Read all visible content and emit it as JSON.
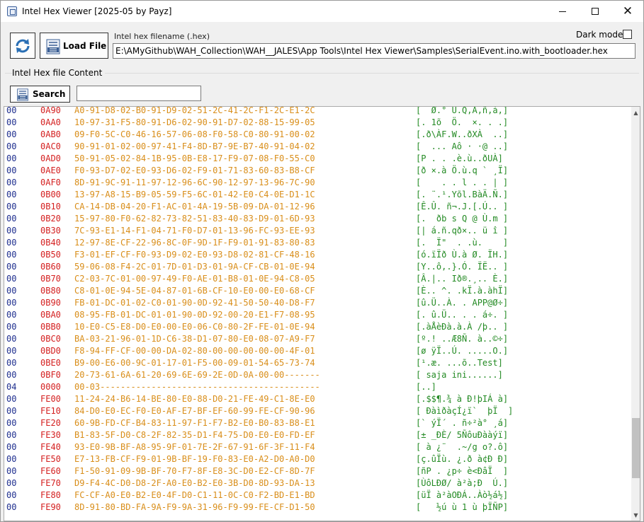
{
  "window": {
    "title": "Intel Hex Viewer [2025-05 by Payz]"
  },
  "toolbar": {
    "load_label": "Load File",
    "filename_label": "Intel hex filename (.hex)",
    "filename_value": "E:\\AMyGithub\\WAH_Collection\\WAH__JALES\\App Tools\\Intel Hex Viewer\\Samples\\SerialEvent.ino.with_bootloader.hex",
    "dark_mode_label": "Dark mode",
    "dark_mode_checked": false
  },
  "content": {
    "group_label": "Intel Hex file Content",
    "search_label": "Search",
    "search_value": ""
  },
  "colors": {
    "record_type": "#1f2f8f",
    "address": "#d42020",
    "hex_data": "#d98e1a",
    "ascii": "#238a23"
  },
  "rows": [
    {
      "type": "00",
      "addr": "0A90",
      "hex": "A0-91-D8-02-B0-91-D9-02-51-2C-41-2C-F1-2C-E1-2C",
      "ascii": "[  Ø.° Ù.Q,A,ñ,á,]"
    },
    {
      "type": "00",
      "addr": "0AA0",
      "hex": "10-97-31-F5-80-91-D6-02-90-91-D7-02-88-15-99-05",
      "ascii": "[. 1õ  Ö.  ×. . .]"
    },
    {
      "type": "00",
      "addr": "0AB0",
      "hex": "09-F0-5C-C0-46-16-57-06-08-F0-58-C0-80-91-00-02",
      "ascii": "[.ð\\ÀF.W..ðXÀ  ..]"
    },
    {
      "type": "00",
      "addr": "0AC0",
      "hex": "90-91-01-02-00-97-41-F4-8D-B7-9E-B7-40-91-04-02",
      "ascii": "[  ... Aô · ·@ ..]"
    },
    {
      "type": "00",
      "addr": "0AD0",
      "hex": "50-91-05-02-84-1B-95-0B-E8-17-F9-07-08-F0-55-C0",
      "ascii": "[P . . .è.ù..ðUÀ]"
    },
    {
      "type": "00",
      "addr": "0AE0",
      "hex": "F0-93-D7-02-E0-93-D6-02-F9-01-71-83-60-83-B8-CF",
      "ascii": "[ð ×.à Ö.ù.q ` ¸Ï]"
    },
    {
      "type": "00",
      "addr": "0AF0",
      "hex": "8D-91-9C-91-11-97-12-96-6C-90-12-97-13-96-7C-90",
      "ascii": "[    . . l . . | ]"
    },
    {
      "type": "00",
      "addr": "0B00",
      "hex": "13-97-A8-15-B9-05-59-F5-6C-01-42-E0-C4-0E-D1-1C",
      "ascii": "[. ¨.¹.Yõl.BàÄ.Ñ.]"
    },
    {
      "type": "00",
      "addr": "0B10",
      "hex": "CA-14-DB-04-20-F1-AC-01-4A-19-5B-09-DA-01-12-96",
      "ascii": "[Ê.Û. ñ¬.J.[.Ú.. ]"
    },
    {
      "type": "00",
      "addr": "0B20",
      "hex": "15-97-80-F0-62-82-73-82-51-83-40-83-D9-01-6D-93",
      "ascii": "[.  ðb s Q @ Ù.m ]"
    },
    {
      "type": "00",
      "addr": "0B30",
      "hex": "7C-93-E1-14-F1-04-71-F0-D7-01-13-96-FC-93-EE-93",
      "ascii": "[| á.ñ.qð×.. ü î ]"
    },
    {
      "type": "00",
      "addr": "0B40",
      "hex": "12-97-8E-CF-22-96-8C-0F-9D-1F-F9-01-91-83-80-83",
      "ascii": "[.  Ï\"  . .ù.    ]"
    },
    {
      "type": "00",
      "addr": "0B50",
      "hex": "F3-01-EF-CF-F0-93-D9-02-E0-93-D8-02-81-CF-48-16",
      "ascii": "[ó.ïÏð Ù.à Ø. ÏH.]"
    },
    {
      "type": "00",
      "addr": "0B60",
      "hex": "59-06-08-F4-2C-01-7D-01-D3-01-9A-CF-CB-01-0E-94",
      "ascii": "[Y..ô,.}.Ó. ÏË.. ]"
    },
    {
      "type": "00",
      "addr": "0B70",
      "hex": "C2-03-7C-01-00-97-49-F0-AE-01-B8-01-0E-94-C8-05",
      "ascii": "[Â.|.. Ið®.¸.. È.]"
    },
    {
      "type": "00",
      "addr": "0B80",
      "hex": "C8-01-0E-94-5E-04-87-01-6B-CF-10-E0-00-E0-68-CF",
      "ascii": "[È.. ^. .kÏ.à.àhÏ]"
    },
    {
      "type": "00",
      "addr": "0B90",
      "hex": "FB-01-DC-01-02-C0-01-90-0D-92-41-50-50-40-D8-F7",
      "ascii": "[û.Ü..À. . APP@Ø÷]"
    },
    {
      "type": "00",
      "addr": "0BA0",
      "hex": "08-95-FB-01-DC-01-01-90-0D-92-00-20-E1-F7-08-95",
      "ascii": "[. û.Ü.. . . á÷. ]"
    },
    {
      "type": "00",
      "addr": "0BB0",
      "hex": "10-E0-C5-E8-D0-E0-00-E0-06-C0-80-2F-FE-01-0E-94",
      "ascii": "[.àÅèÐà.à.À /þ.. ]"
    },
    {
      "type": "00",
      "addr": "0BC0",
      "hex": "BA-03-21-96-01-1D-C6-38-D1-07-80-E0-08-07-A9-F7",
      "ascii": "[º.! ..Æ8Ñ. à..©÷]"
    },
    {
      "type": "00",
      "addr": "0BD0",
      "hex": "F8-94-FF-CF-00-00-DA-02-80-00-00-00-00-00-4F-01",
      "ascii": "[ø ÿÏ..Ú. .....O.]"
    },
    {
      "type": "00",
      "addr": "0BE0",
      "hex": "B9-00-E6-00-9C-01-17-01-F5-00-09-01-54-65-73-74",
      "ascii": "[¹.æ. ...õ..Test]"
    },
    {
      "type": "00",
      "addr": "0BF0",
      "hex": "20-73-61-6A-61-20-69-6E-69-2E-0D-0A-00-00-------",
      "ascii": "[ saja ini......]"
    },
    {
      "type": "04",
      "addr": "0000",
      "hex": "00-03-------------------------------------------",
      "ascii": "[..]"
    },
    {
      "type": "00",
      "addr": "FE00",
      "hex": "11-24-24-B6-14-BE-80-E0-88-D0-21-FE-49-C1-8E-E0",
      "ascii": "[.$$¶.¾ à Ð!þIÁ à]"
    },
    {
      "type": "00",
      "addr": "FE10",
      "hex": "84-D0-E0-EC-F0-E0-AF-E7-BF-EF-60-99-FE-CF-90-96",
      "ascii": "[ ÐàìðàçÍ¿ï`  þÏ  ]"
    },
    {
      "type": "00",
      "addr": "FE20",
      "hex": "60-9B-FD-CF-B4-83-11-97-F1-F7-B2-E0-B0-83-B8-E1",
      "ascii": "[` ýÏ´ . ñ÷²à° ¸á]"
    },
    {
      "type": "00",
      "addr": "FE30",
      "hex": "B1-83-5F-D0-C8-2F-82-35-D1-F4-75-D0-E0-E0-FD-EF",
      "ascii": "[± _ÐÈ/ 5ÑôuÐààýï]"
    },
    {
      "type": "00",
      "addr": "FE40",
      "hex": "93-E0-9B-BF-A8-95-9F-01-7E-2F-67-91-6F-3F-11-F4",
      "ascii": "[ à ¿¨  .~/g o?.ô]"
    },
    {
      "type": "00",
      "addr": "FE50",
      "hex": "E7-13-FB-CF-F9-01-9B-BF-19-F0-83-E0-A2-D0-A0-D0",
      "ascii": "[ç.ûÏù. ¿.ð à¢Ð Ð]"
    },
    {
      "type": "00",
      "addr": "FE60",
      "hex": "F1-50-91-09-9B-BF-70-F7-8F-E8-3C-D0-E2-CF-8D-7F",
      "ascii": "[ñP . ¿p÷ è<ÐâÏ  ]"
    },
    {
      "type": "00",
      "addr": "FE70",
      "hex": "D9-F4-4C-D0-D8-2F-A0-E0-B2-E0-3B-D0-8D-93-DA-13",
      "ascii": "[ÙôLÐØ/ à²à;Ð  Ú.]"
    },
    {
      "type": "00",
      "addr": "FE80",
      "hex": "FC-CF-A0-E0-B2-E0-4F-D0-C1-11-0C-C0-F2-BD-E1-BD",
      "ascii": "[üÏ à²àOÐÁ..Àò½á½]"
    },
    {
      "type": "00",
      "addr": "FE90",
      "hex": "8D-91-80-BD-FA-9A-F9-9A-31-96-F9-99-FE-CF-D1-50",
      "ascii": "[   ½ú ù 1 ù þÏÑP]"
    }
  ]
}
